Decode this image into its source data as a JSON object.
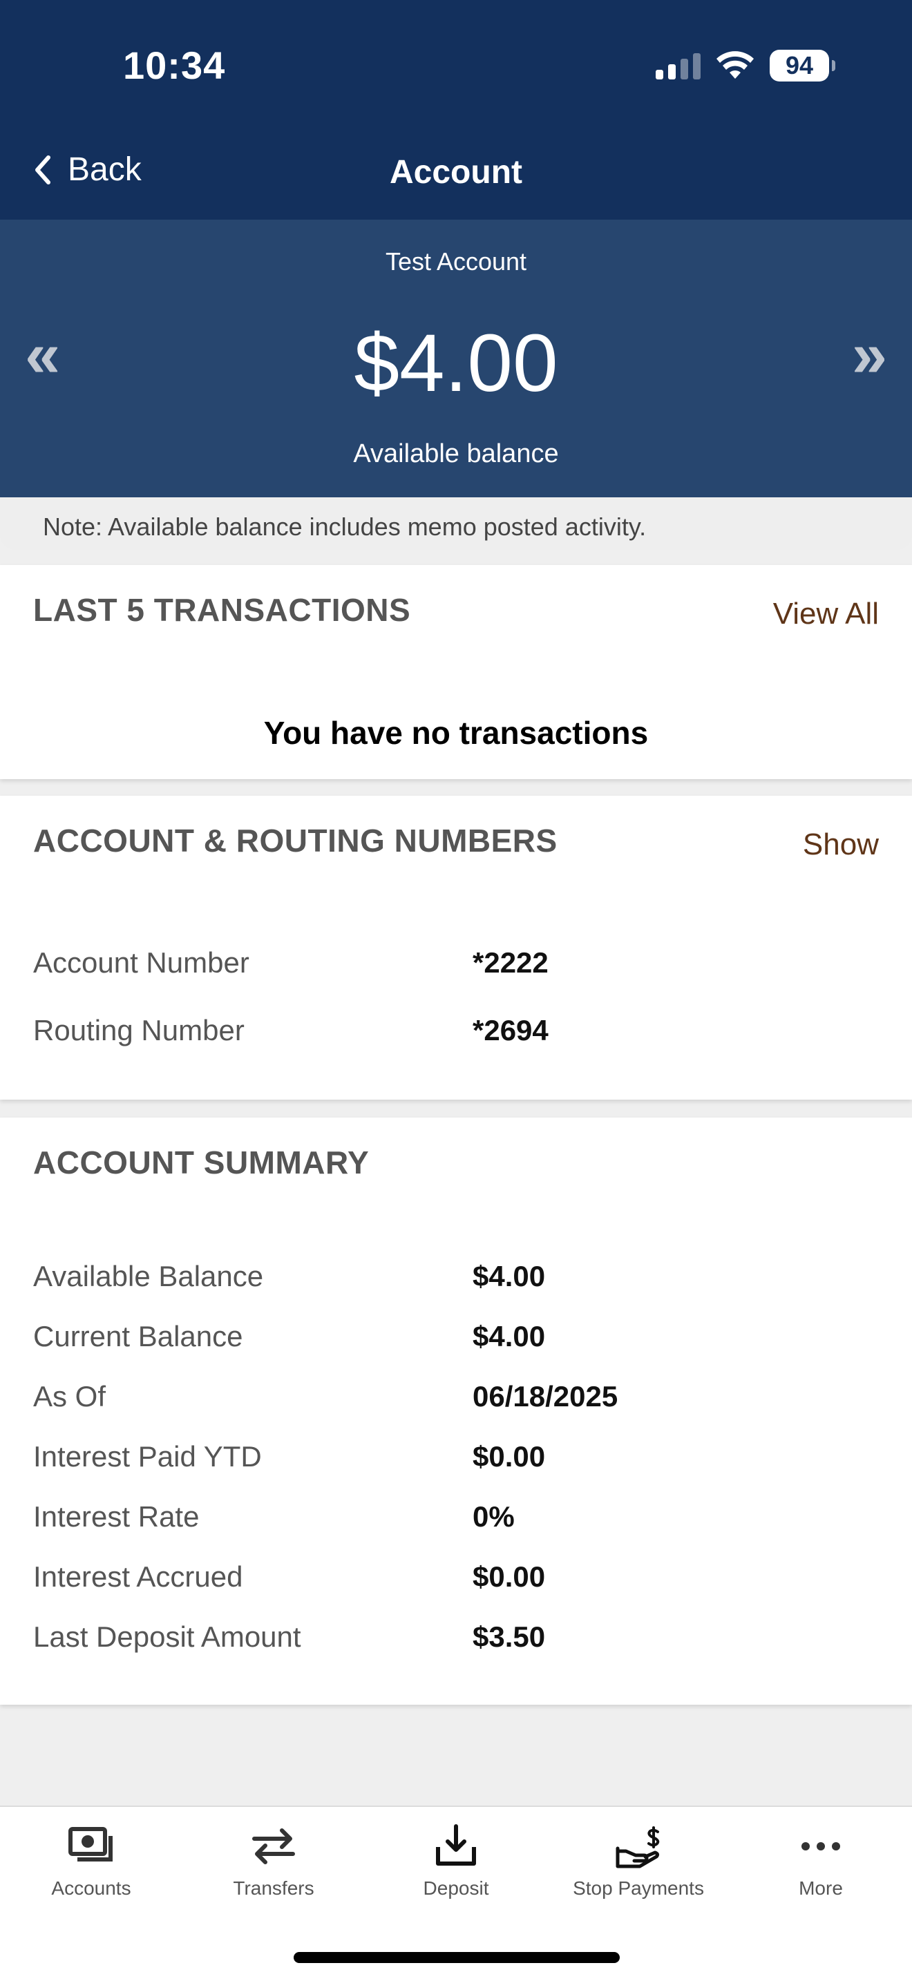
{
  "status": {
    "time": "10:34",
    "battery": "94"
  },
  "nav": {
    "back_label": "Back",
    "title": "Account"
  },
  "balance": {
    "account_name": "Test Account",
    "amount": "$4.00",
    "label": "Available balance",
    "prev_glyph": "«",
    "next_glyph": "»"
  },
  "note": "Note: Available balance includes memo posted activity.",
  "transactions": {
    "title": "LAST 5 TRANSACTIONS",
    "view_all": "View All",
    "empty": "You have no transactions"
  },
  "routing": {
    "title": "ACCOUNT & ROUTING NUMBERS",
    "show": "Show",
    "rows": [
      {
        "label": "Account Number",
        "value": "*2222"
      },
      {
        "label": "Routing Number",
        "value": "*2694"
      }
    ]
  },
  "summary": {
    "title": "ACCOUNT SUMMARY",
    "rows": [
      {
        "label": "Available Balance",
        "value": "$4.00"
      },
      {
        "label": "Current Balance",
        "value": "$4.00"
      },
      {
        "label": "As Of",
        "value": "06/18/2025"
      },
      {
        "label": "Interest Paid YTD",
        "value": "$0.00"
      },
      {
        "label": "Interest Rate",
        "value": "0%"
      },
      {
        "label": "Interest Accrued",
        "value": "$0.00"
      },
      {
        "label": "Last Deposit Amount",
        "value": "$3.50"
      }
    ]
  },
  "tabs": [
    {
      "label": "Accounts",
      "icon": "accounts-icon"
    },
    {
      "label": "Transfers",
      "icon": "transfers-icon"
    },
    {
      "label": "Deposit",
      "icon": "deposit-icon"
    },
    {
      "label": "Stop Payments",
      "icon": "stop-payments-icon"
    },
    {
      "label": "More",
      "icon": "more-icon"
    }
  ],
  "colors": {
    "nav_bg": "#13305d",
    "balance_bg": "#27466f",
    "link": "#5f3518",
    "heading_gray": "#555555"
  }
}
